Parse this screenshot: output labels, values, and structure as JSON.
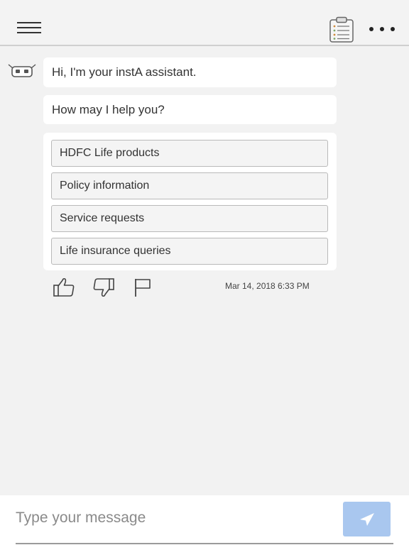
{
  "header": {
    "menu_icon": "hamburger-menu-icon",
    "clipboard_icon": "clipboard-list-icon",
    "more_icon": "more-horizontal-icon"
  },
  "chat": {
    "avatar_icon": "robot-assistant-icon",
    "messages": [
      "Hi, I'm your instA assistant.",
      "How may I help you?"
    ],
    "options": [
      "HDFC Life products",
      "Policy information",
      "Service requests",
      "Life insurance queries"
    ],
    "feedback": {
      "like_icon": "thumbs-up-icon",
      "dislike_icon": "thumbs-down-icon",
      "flag_icon": "flag-icon"
    },
    "timestamp": "Mar 14, 2018 6:33 PM"
  },
  "composer": {
    "placeholder": "Type your message",
    "value": "",
    "send_icon": "send-arrow-icon"
  },
  "colors": {
    "background": "#f2f2f2",
    "send_button": "#a9c7ef"
  }
}
